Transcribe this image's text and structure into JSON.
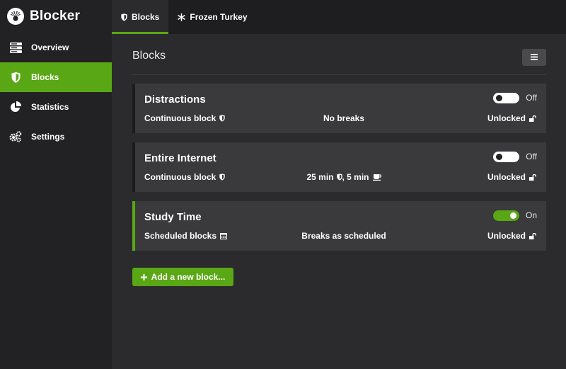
{
  "app": {
    "title": "Blocker",
    "brand_color": "#5aa715"
  },
  "sidebar": {
    "items": [
      {
        "label": "Overview",
        "icon": "server-icon"
      },
      {
        "label": "Blocks",
        "icon": "shield-icon",
        "active": true
      },
      {
        "label": "Statistics",
        "icon": "pie-chart-icon"
      },
      {
        "label": "Settings",
        "icon": "cogs-icon"
      }
    ]
  },
  "tabs": [
    {
      "label": "Blocks",
      "icon": "shield-icon",
      "active": true
    },
    {
      "label": "Frozen Turkey",
      "icon": "snowflake-icon"
    }
  ],
  "main": {
    "title": "Blocks",
    "menu_icon": "hamburger-icon",
    "blocks": [
      {
        "name": "Distractions",
        "mode": "Continuous block",
        "breaks_text": "No breaks",
        "lock": "Unlocked",
        "toggle": "Off"
      },
      {
        "name": "Entire Internet",
        "mode": "Continuous block",
        "breaks_work": "25 min",
        "breaks_sep": ", ",
        "breaks_rest": "5 min",
        "lock": "Unlocked",
        "toggle": "Off"
      },
      {
        "name": "Study Time",
        "mode": "Scheduled blocks",
        "breaks_text": "Breaks as scheduled",
        "lock": "Unlocked",
        "toggle": "On"
      }
    ],
    "add_button": "Add a new block..."
  }
}
